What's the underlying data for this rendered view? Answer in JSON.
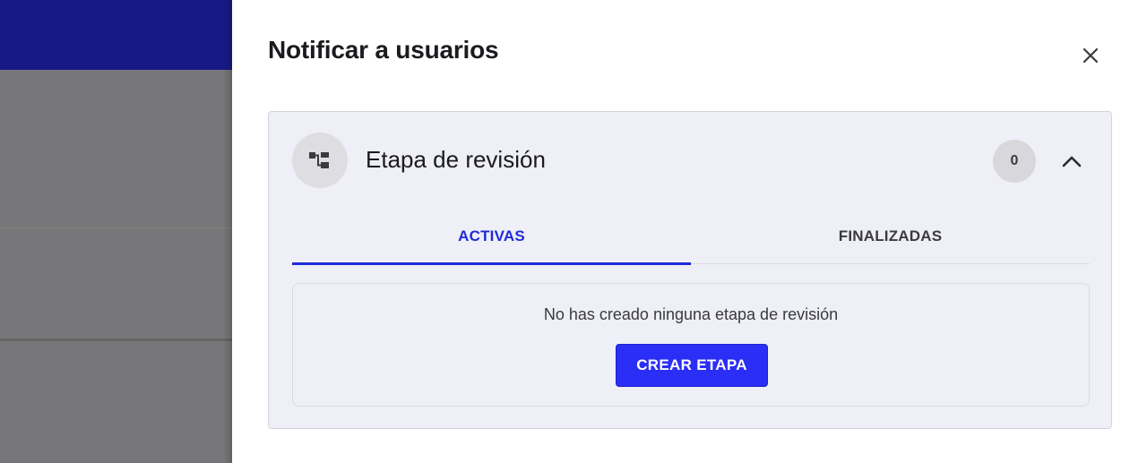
{
  "drawer": {
    "title": "Notificar a usuarios",
    "close_icon": "close-icon"
  },
  "review_stage": {
    "icon": "hierarchy-icon",
    "title": "Etapa de revisión",
    "count": "0",
    "chevron_icon": "chevron-up-icon",
    "tabs": [
      {
        "label": "ACTIVAS",
        "active": true
      },
      {
        "label": "FINALIZADAS",
        "active": false
      }
    ],
    "empty_message": "No has creado ninguna etapa de revisión",
    "create_button_label": "CREAR ETAPA"
  },
  "colors": {
    "accent": "#1f2bd6",
    "button": "#2b2ef5",
    "topbar": "#1a1a8c",
    "card_bg": "#eeeff7"
  }
}
